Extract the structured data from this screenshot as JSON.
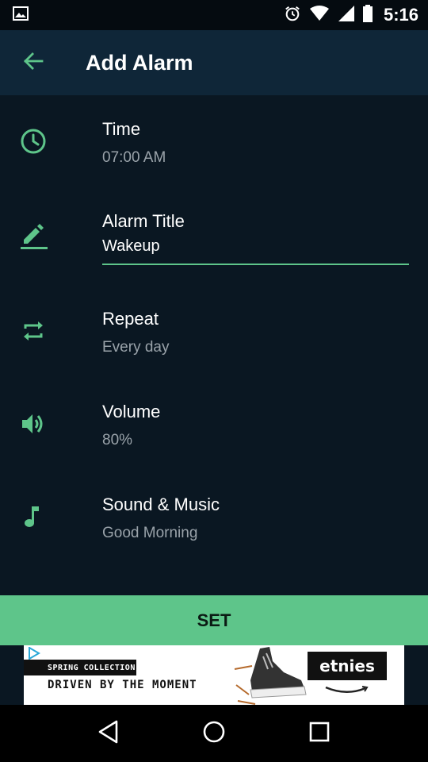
{
  "status_bar": {
    "time": "5:16",
    "icons": [
      "image-icon",
      "alarm-clock-icon",
      "wifi-icon",
      "cell-signal-icon",
      "battery-icon"
    ]
  },
  "app_bar": {
    "title": "Add Alarm",
    "back_icon": "arrow-left-icon"
  },
  "colors": {
    "accent": "#5ec58a",
    "background": "#0a1722",
    "app_bar": "#0f2638"
  },
  "settings": {
    "time": {
      "label": "Time",
      "value": "07:00 AM",
      "icon": "clock-icon"
    },
    "alarm_title": {
      "label": "Alarm Title",
      "value": "Wakeup",
      "icon": "pencil-icon"
    },
    "repeat": {
      "label": "Repeat",
      "value": "Every day",
      "icon": "repeat-icon"
    },
    "volume": {
      "label": "Volume",
      "value": "80%",
      "icon": "speaker-icon"
    },
    "sound": {
      "label": "Sound & Music",
      "value": "Good Morning",
      "icon": "music-note-icon"
    }
  },
  "set_button": {
    "label": "SET"
  },
  "ad": {
    "tag": "SPRING COLLECTION",
    "headline": "DRIVEN BY THE MOMENT",
    "brand": "etnies"
  },
  "nav_bar": {
    "icons": [
      "back-triangle-icon",
      "home-circle-icon",
      "recents-square-icon"
    ]
  }
}
